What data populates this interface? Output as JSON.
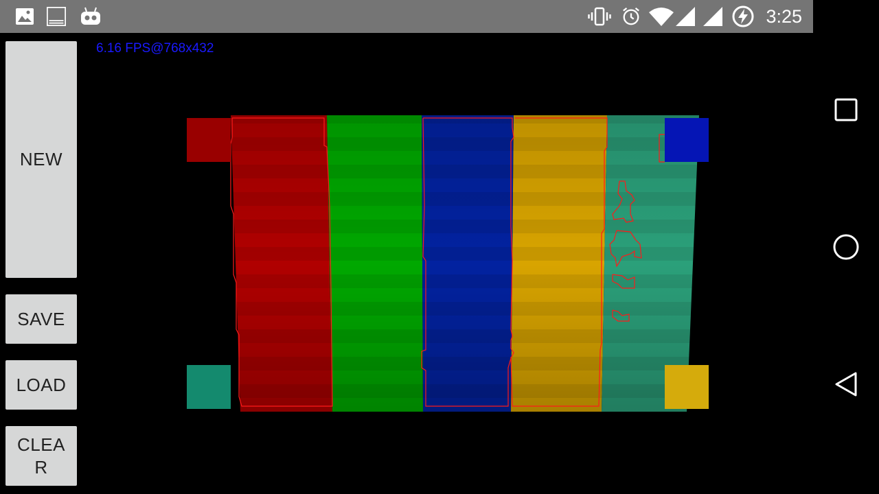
{
  "status_bar": {
    "time": "3:25",
    "left_icons": [
      "image-icon",
      "keyboard-icon",
      "robot-icon"
    ],
    "right_icons": [
      "vibrate-icon",
      "alarm-icon",
      "wifi-icon",
      "cell-signal-icon",
      "cell-signal-2-icon",
      "battery-charging-icon"
    ]
  },
  "buttons": {
    "new_label": "NEW",
    "save_label": "SAVE",
    "load_label": "LOAD",
    "clear_label": "CLEA R"
  },
  "overlay": {
    "fps_text": "6.16 FPS@768x432"
  },
  "nav_bar": {
    "icons": [
      "recents-icon",
      "home-icon",
      "back-icon"
    ]
  },
  "camera": {
    "stripe_colors": [
      "#b00000",
      "#00a800",
      "#0222a0",
      "#d8a400",
      "#2ba07a"
    ],
    "contour_color": "#ff1a1a",
    "corner_markers": {
      "top_left": "#990000",
      "top_right": "#0515b5",
      "bottom_left": "#148a6e",
      "bottom_right": "#d5ab0c"
    }
  }
}
